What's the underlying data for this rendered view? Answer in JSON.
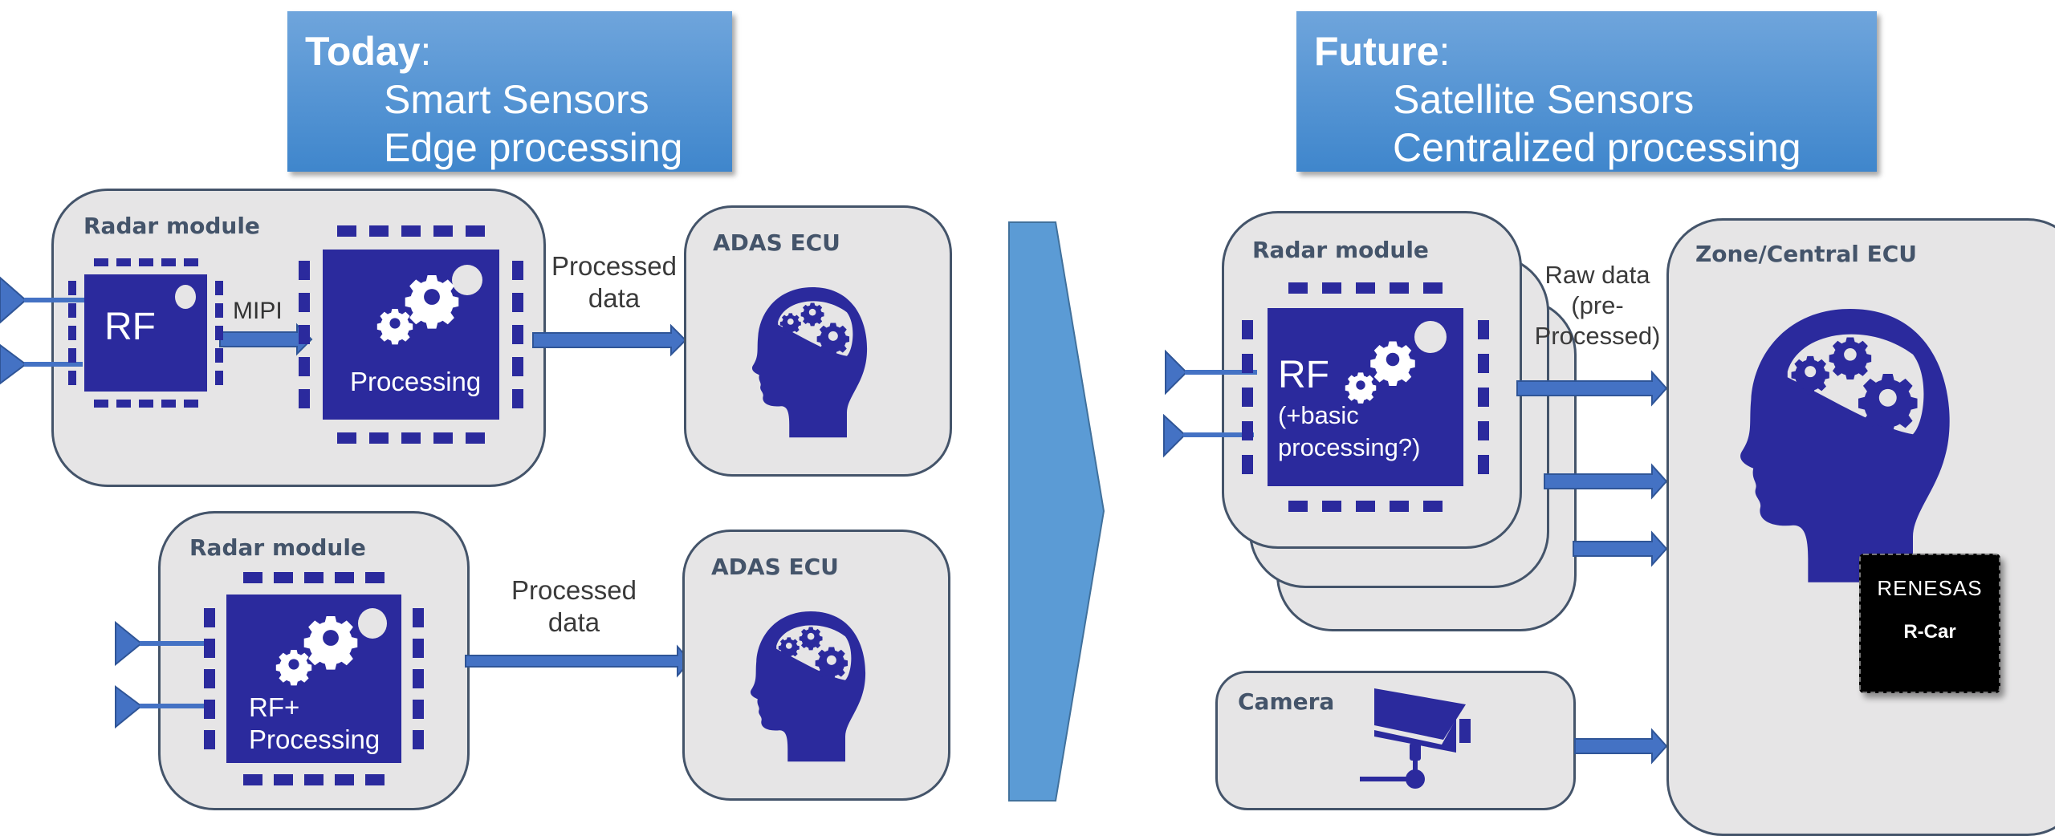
{
  "today": {
    "heading": "Today",
    "colon": ":",
    "lines": [
      "Smart Sensors",
      "Edge processing"
    ]
  },
  "future": {
    "heading": "Future",
    "colon": ":",
    "lines": [
      "Satellite Sensors",
      "Centralized processing"
    ]
  },
  "today_top": {
    "module_label": "Radar module",
    "rf_chip_label": "RF",
    "link_label": "MIPI",
    "processing_chip_label": "Processing",
    "flow_label": [
      "Processed",
      "data"
    ],
    "ecu_label": "ADAS ECU"
  },
  "today_bottom": {
    "module_label": "Radar module",
    "chip_label": [
      "RF+",
      "Processing"
    ],
    "flow_label": [
      "Processed",
      "data"
    ],
    "ecu_label": "ADAS ECU"
  },
  "future_side": {
    "module_label": "Radar module",
    "chip_label_main": "RF",
    "chip_label_sub": [
      "(+basic",
      "processing?)"
    ],
    "flow_label": [
      "Raw data",
      "(pre-",
      "Processed)"
    ],
    "camera_label": "Camera",
    "ecu_label": "Zone/Central ECU",
    "soc_brand": "RENESAS",
    "soc_name": "R-Car"
  },
  "icons": {
    "antenna": "antenna-triangle-icon",
    "gears": "gears-icon",
    "brain_head": "head-with-gears-icon",
    "camera": "security-camera-icon",
    "arrow": "right-arrow-icon",
    "transition": "chevron-right-icon"
  },
  "colors": {
    "title_top": "#6fa5dc",
    "title_bottom": "#3f86cc",
    "module_fill": "#e6e5e6",
    "module_border": "#44546a",
    "chip": "#2b2a9d",
    "arrow": "#4472c4",
    "chevron": "#5b9bd5",
    "soc": "#000000"
  }
}
